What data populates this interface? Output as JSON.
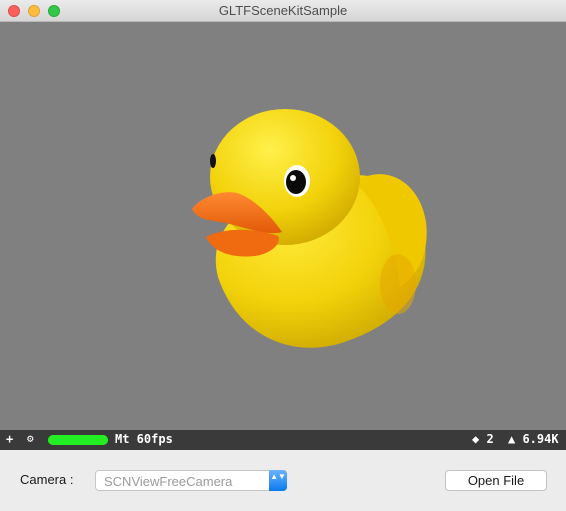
{
  "window": {
    "title": "GLTFSceneKitSample"
  },
  "stats": {
    "add_glyph": "+",
    "settings_glyph": "⚙",
    "fps_level": 1.0,
    "fps_label": "Mt 60fps",
    "nodes_label": "◆ 2",
    "triangles_label": "▲ 6.94K"
  },
  "controls": {
    "camera_label": "Camera :",
    "camera_value": "SCNViewFreeCamera",
    "popup_arrows": "▲▼",
    "open_file_label": "Open File"
  },
  "colors": {
    "viewport_bg": "#808080",
    "duck_yellow": "#f2d20a",
    "beak_orange": "#f06a10",
    "stats_bg": "#3a3a3a",
    "fps_green": "#22ee22",
    "accent_blue": "#0a7aef"
  }
}
